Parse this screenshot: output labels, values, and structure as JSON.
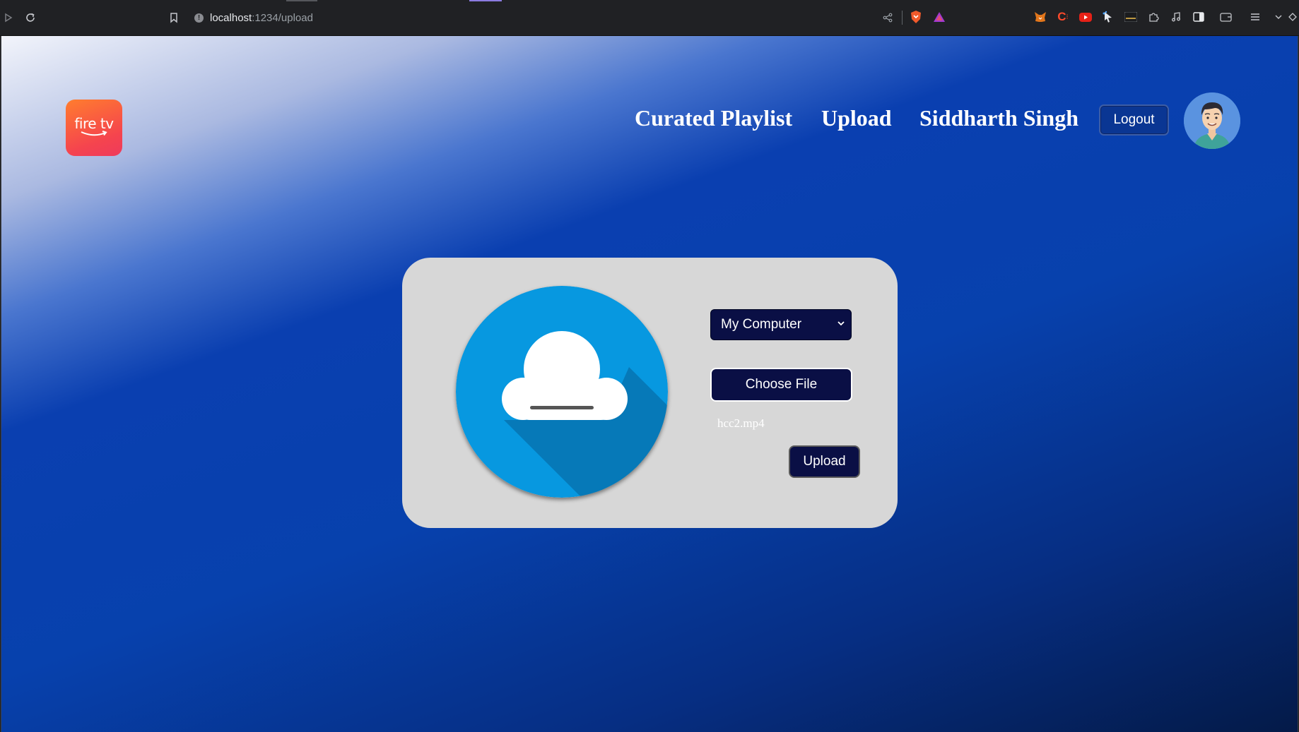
{
  "browser": {
    "url_host": "localhost",
    "url_path": ":1234/upload",
    "icons": {
      "back": "play-icon",
      "reload": "reload-icon",
      "bookmark": "bookmark-icon",
      "site_info": "info-icon",
      "share": "share-icon",
      "brave": "brave-shield-icon",
      "rewards": "brave-rewards-icon",
      "extensions": [
        "metamask-icon",
        "c-extension-icon",
        "youtube-icon",
        "cursor-icon",
        "terminal-icon",
        "puzzle-icon",
        "music-icon",
        "sidebar-icon",
        "wallet-icon",
        "menu-icon",
        "chevron-down-icon"
      ]
    }
  },
  "header": {
    "logo_text": "fire tv",
    "nav": {
      "curated": "Curated Playlist",
      "upload": "Upload",
      "user": "Siddharth Singh"
    },
    "logout_label": "Logout",
    "avatar_icon": "user-avatar"
  },
  "upload_card": {
    "source_select_value": "My Computer",
    "choose_file_label": "Choose File",
    "selected_file": "hcc2.mp4",
    "upload_label": "Upload",
    "cloud_icon": "cloud-upload-icon"
  },
  "colors": {
    "button_bg": "#0a0f45",
    "card_bg": "#d7d7d7",
    "cloud_circle": "#0798e0",
    "logo_gradient_start": "#ff7d2e",
    "logo_gradient_end": "#ee3a5c"
  }
}
